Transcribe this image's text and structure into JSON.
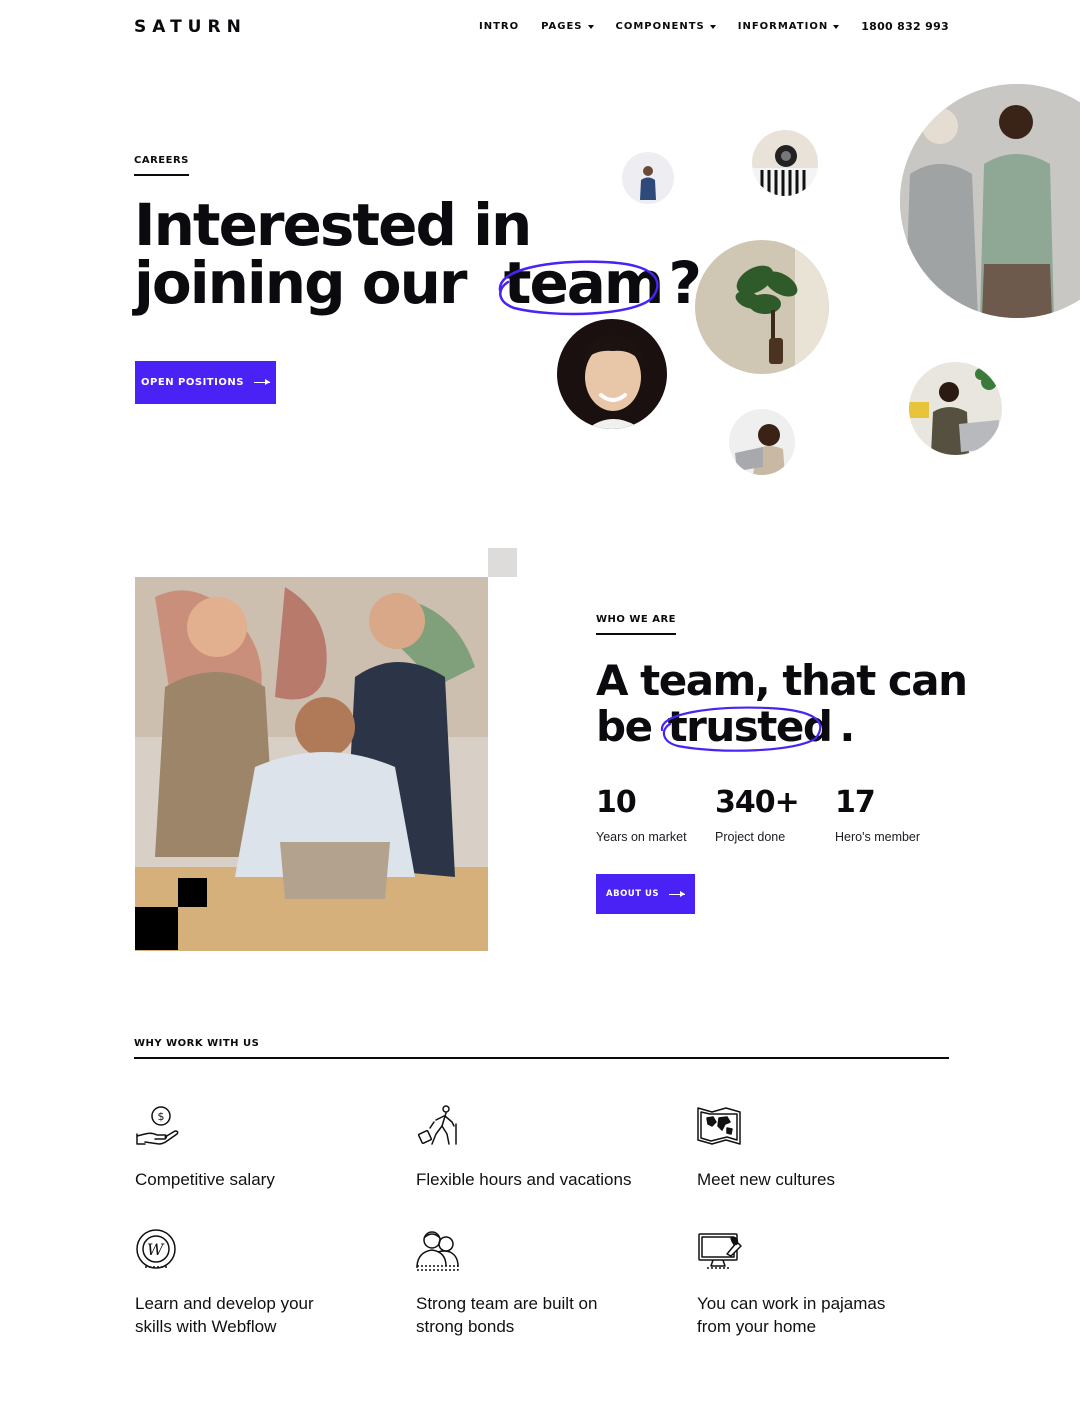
{
  "nav": {
    "logo": "SATURN",
    "items": [
      {
        "label": "INTRO",
        "dropdown": false
      },
      {
        "label": "PAGES",
        "dropdown": true
      },
      {
        "label": "COMPONENTS",
        "dropdown": true
      },
      {
        "label": "INFORMATION",
        "dropdown": true
      }
    ],
    "phone": "1800 832 993"
  },
  "hero": {
    "eyebrow": "CAREERS",
    "title_line1": "Interested in",
    "title_line2_pre": "joining our",
    "title_highlight": "team",
    "title_suffix": "?",
    "button": "OPEN POSITIONS"
  },
  "about": {
    "eyebrow": "WHO WE ARE",
    "title_line1": "A team, that can",
    "title_line2_pre": "be",
    "title_highlight": "trusted",
    "title_suffix": ".",
    "stats": [
      {
        "number": "10",
        "label": "Years on market"
      },
      {
        "number": "340+",
        "label": "Project done"
      },
      {
        "number": "17",
        "label": "Hero's member"
      }
    ],
    "button": "ABOUT US"
  },
  "why": {
    "eyebrow": "WHY WORK WITH US",
    "features": [
      {
        "icon": "salary-hand-icon",
        "line1": "Competitive salary",
        "line2": ""
      },
      {
        "icon": "traveler-icon",
        "line1": "Flexible hours and vacations",
        "line2": ""
      },
      {
        "icon": "world-map-icon",
        "line1": "Meet new cultures",
        "line2": ""
      },
      {
        "icon": "webflow-icon",
        "line1": "Learn and develop your",
        "line2": "skills with Webflow"
      },
      {
        "icon": "team-people-icon",
        "line1": "Strong team are built on",
        "line2": "strong bonds"
      },
      {
        "icon": "computer-icon",
        "line1": "You can work in pajamas",
        "line2": "from your home"
      }
    ]
  },
  "colors": {
    "accent": "#4a22f5",
    "text": "#0b0b0f",
    "background": "#ffffff"
  }
}
